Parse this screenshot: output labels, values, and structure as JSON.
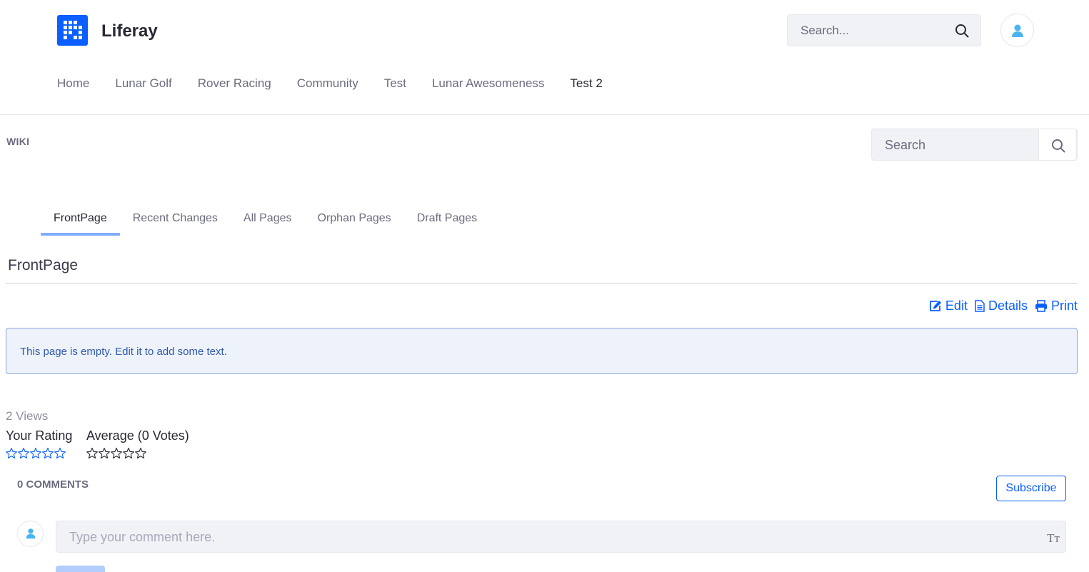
{
  "header": {
    "site_name": "Liferay",
    "search_placeholder": "Search...",
    "nav": [
      "Home",
      "Lunar Golf",
      "Rover Racing",
      "Community",
      "Test",
      "Lunar Awesomeness",
      "Test 2"
    ],
    "active_nav": "Test 2"
  },
  "wiki": {
    "portlet_title": "WIKI",
    "search_placeholder": "Search",
    "tabs": [
      "FrontPage",
      "Recent Changes",
      "All Pages",
      "Orphan Pages",
      "Draft Pages"
    ],
    "active_tab": "FrontPage",
    "page_title": "FrontPage",
    "actions": {
      "edit": "Edit",
      "details": "Details",
      "print": "Print"
    },
    "empty_message": "This page is empty. Edit it to add some text.",
    "views": "2 Views",
    "your_rating_label": "Your Rating",
    "average_label": "Average (0 Votes)",
    "your_rating_value": 0,
    "average_rating_value": 0,
    "max_stars": 5
  },
  "comments": {
    "title": "0 COMMENTS",
    "subscribe_label": "Subscribe",
    "input_placeholder": "Type your comment here.",
    "format_icon_text": "Tт"
  },
  "colors": {
    "accent": "#0b5fff",
    "tab_indicator": "#80acff",
    "alert_bg": "#eef2fa",
    "alert_text": "#2e5aac",
    "avatar_icon": "#4ab4f0"
  }
}
